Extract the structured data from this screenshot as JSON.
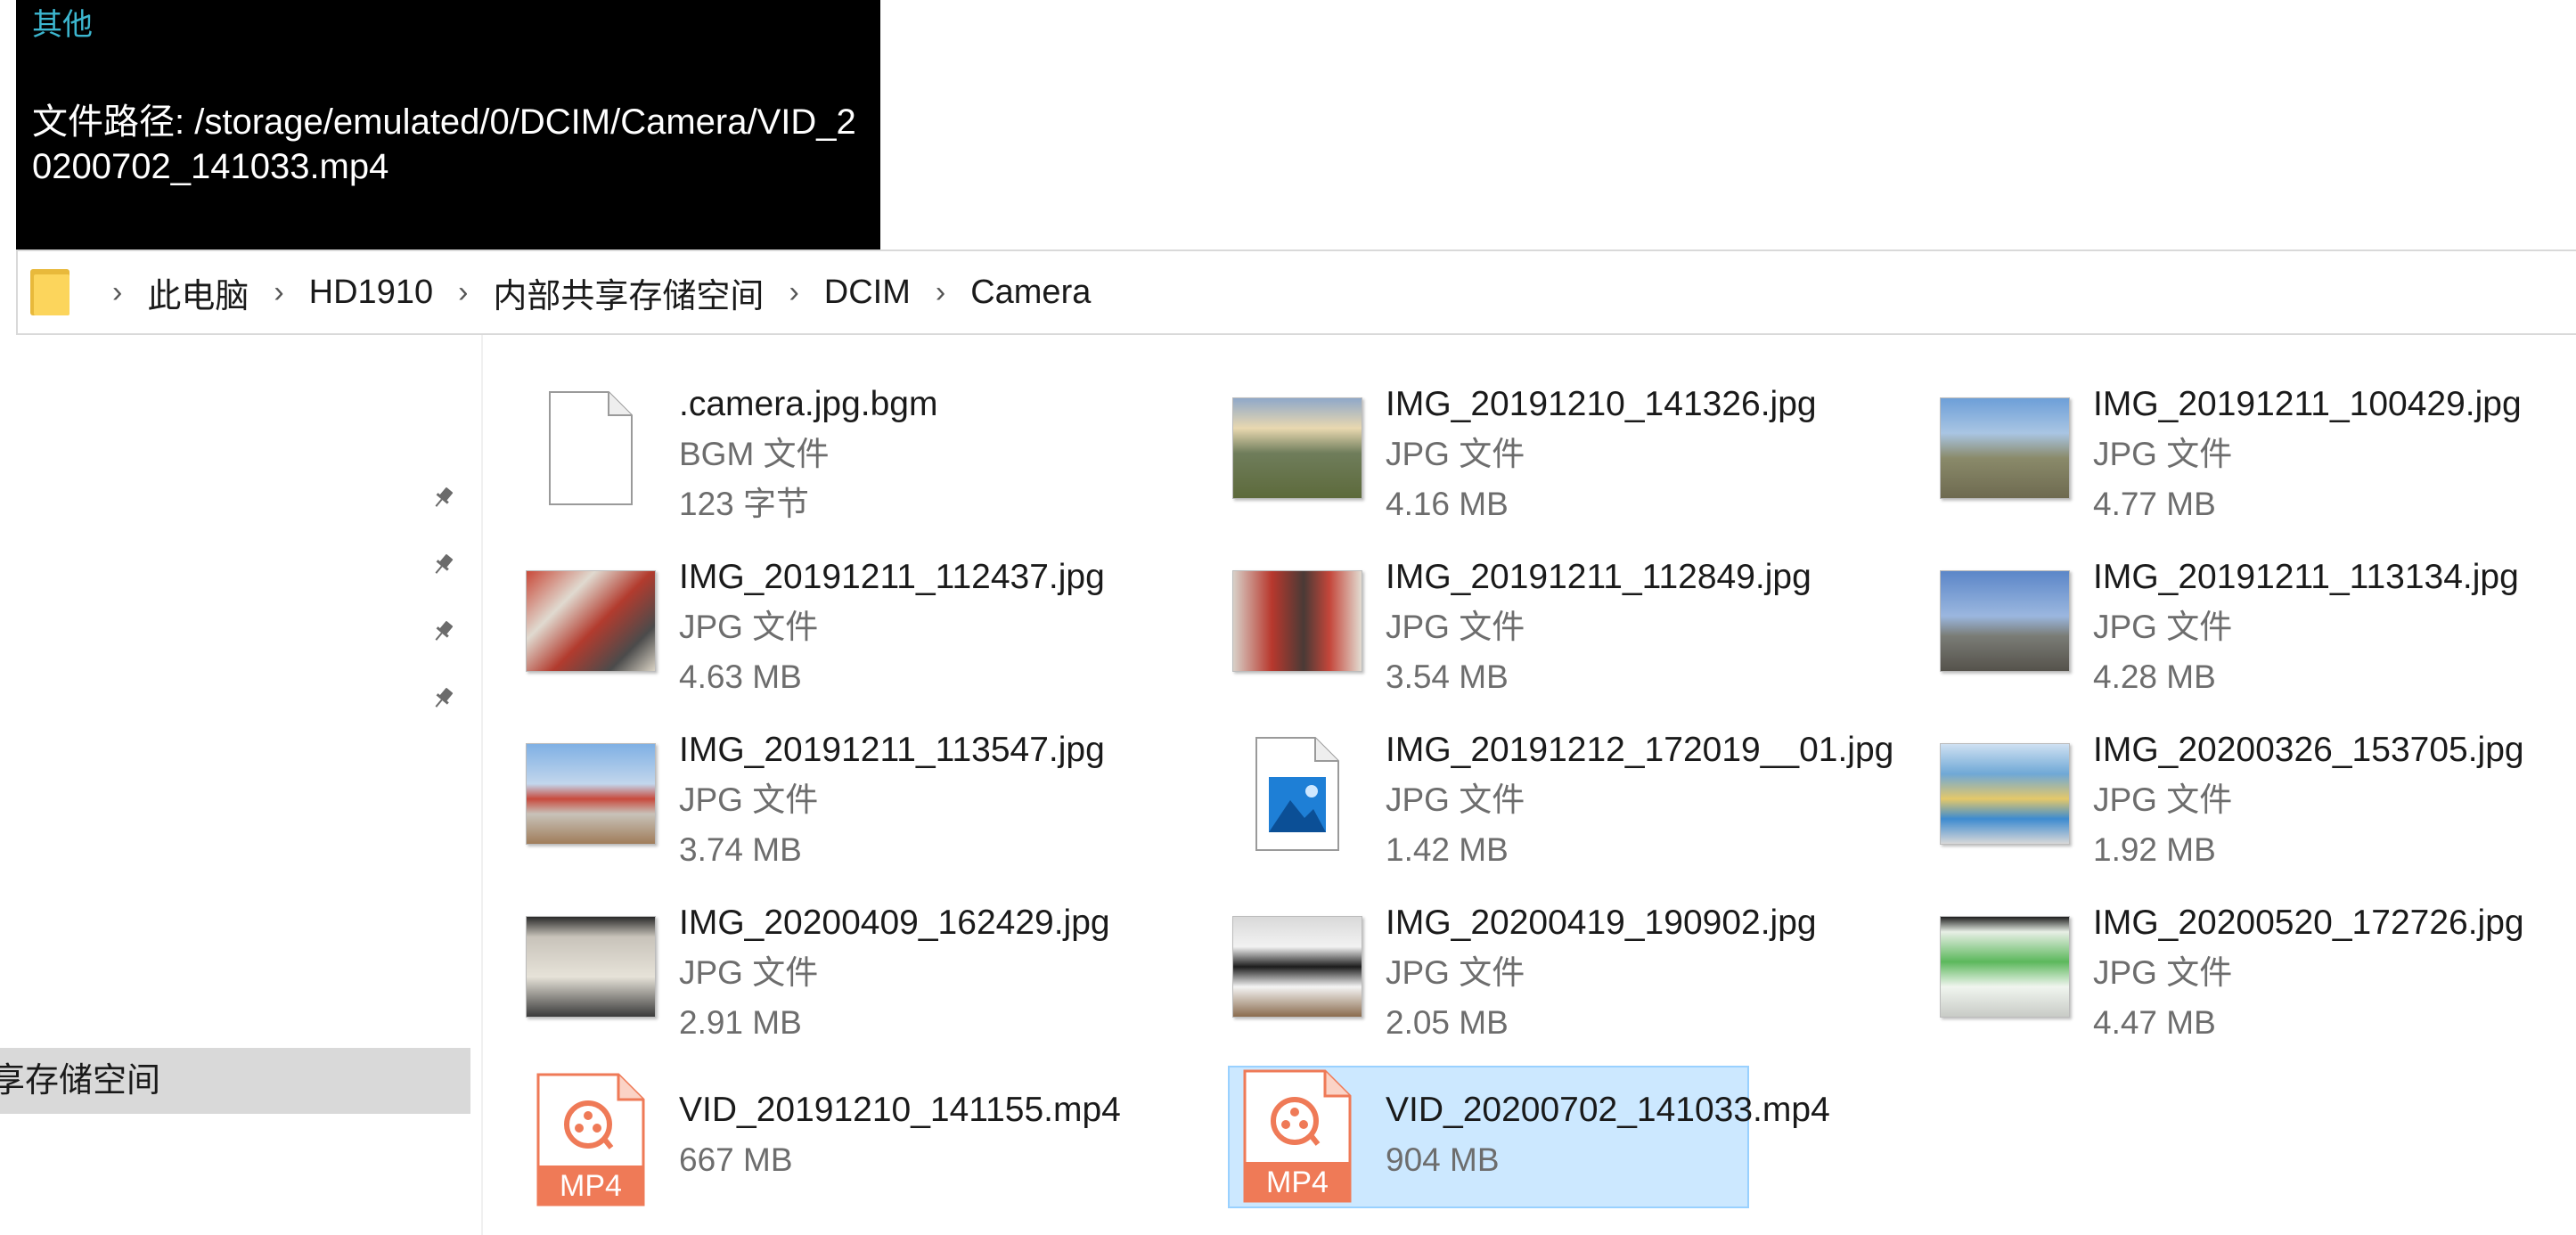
{
  "tooltip": {
    "title": "其他",
    "path_text": "文件路径: /storage/emulated/0/DCIM/Camera/VID_20200702_141033.mp4"
  },
  "breadcrumb": {
    "items": [
      "此电脑",
      "HD1910",
      "内部共享存储空间",
      "DCIM",
      "Camera"
    ],
    "separator": "›"
  },
  "nav": {
    "selected_label": "享存储空间"
  },
  "files": [
    {
      "name": ".camera.jpg.bgm",
      "type": "BGM 文件",
      "size": "123 字节",
      "icon": "generic-file-icon"
    },
    {
      "name": "IMG_20191210_141326.jpg",
      "type": "JPG 文件",
      "size": "4.16 MB",
      "icon": "photo-thumbnail"
    },
    {
      "name": "IMG_20191211_100429.jpg",
      "type": "JPG 文件",
      "size": "4.77 MB",
      "icon": "photo-thumbnail"
    },
    {
      "name": "IMG_20191211_112437.jpg",
      "type": "JPG 文件",
      "size": "4.63 MB",
      "icon": "photo-thumbnail"
    },
    {
      "name": "IMG_20191211_112849.jpg",
      "type": "JPG 文件",
      "size": "3.54 MB",
      "icon": "photo-thumbnail"
    },
    {
      "name": "IMG_20191211_113134.jpg",
      "type": "JPG 文件",
      "size": "4.28 MB",
      "icon": "photo-thumbnail"
    },
    {
      "name": "IMG_20191211_113547.jpg",
      "type": "JPG 文件",
      "size": "3.74 MB",
      "icon": "photo-thumbnail"
    },
    {
      "name": "IMG_20191212_172019__01.jpg",
      "type": "JPG 文件",
      "size": "1.42 MB",
      "icon": "image-file-icon"
    },
    {
      "name": "IMG_20200326_153705.jpg",
      "type": "JPG 文件",
      "size": "1.92 MB",
      "icon": "photo-thumbnail"
    },
    {
      "name": "IMG_20200409_162429.jpg",
      "type": "JPG 文件",
      "size": "2.91 MB",
      "icon": "photo-thumbnail"
    },
    {
      "name": "IMG_20200419_190902.jpg",
      "type": "JPG 文件",
      "size": "2.05 MB",
      "icon": "photo-thumbnail"
    },
    {
      "name": "IMG_20200520_172726.jpg",
      "type": "JPG 文件",
      "size": "4.47 MB",
      "icon": "photo-thumbnail"
    },
    {
      "name": "VID_20191210_141155.mp4",
      "size": "667 MB",
      "icon": "mp4-file-icon",
      "icon_label": "MP4"
    },
    {
      "name": "VID_20200702_141033.mp4",
      "size": "904 MB",
      "icon": "mp4-file-icon",
      "icon_label": "MP4",
      "selected": true
    }
  ],
  "colors": {
    "selection_bg": "#cce8ff",
    "selection_border": "#99d1ff",
    "tooltip_bg": "#000000",
    "tooltip_title": "#3cb6cf",
    "mp4_accent": "#ef7a57",
    "folder": "#fcd55c"
  }
}
